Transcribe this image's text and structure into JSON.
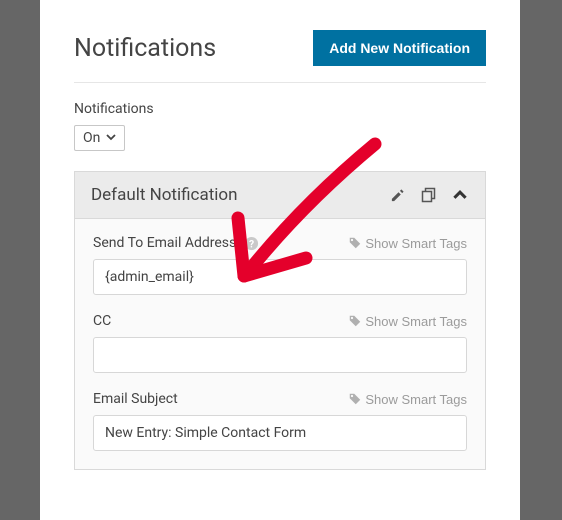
{
  "header": {
    "title": "Notifications",
    "add_button": "Add New Notification"
  },
  "notifications_toggle": {
    "label": "Notifications",
    "value": "On"
  },
  "panel": {
    "title": "Default Notification",
    "fields": {
      "send_to": {
        "label": "Send To Email Address",
        "value": "{admin_email}",
        "smart_tags": "Show Smart Tags"
      },
      "cc": {
        "label": "CC",
        "value": "",
        "smart_tags": "Show Smart Tags"
      },
      "subject": {
        "label": "Email Subject",
        "value": "New Entry: Simple Contact Form",
        "smart_tags": "Show Smart Tags"
      }
    }
  }
}
